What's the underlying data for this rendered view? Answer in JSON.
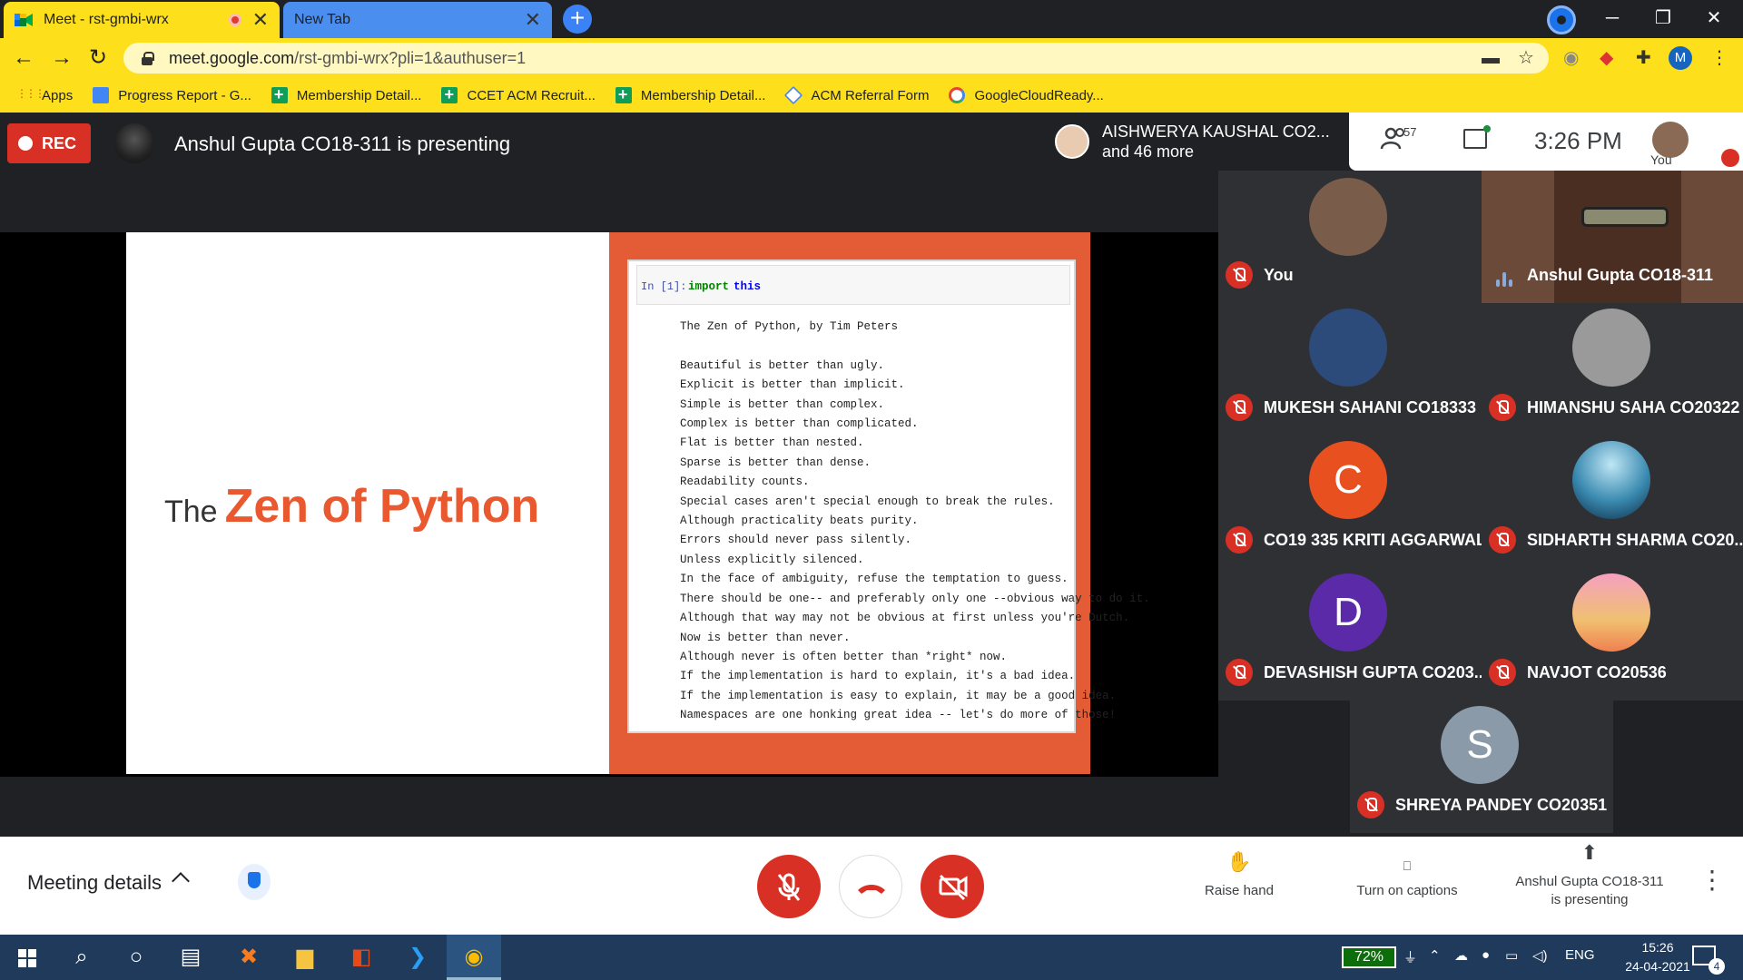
{
  "browser": {
    "tabs": [
      {
        "title": "Meet - rst-gmbi-wrx"
      },
      {
        "title": "New Tab"
      }
    ],
    "url_host": "meet.google.com",
    "url_path": "/rst-gmbi-wrx?pli=1&authuser=1",
    "profile_initial": "M",
    "bookmarks": [
      {
        "label": "Apps",
        "icon": "apps-grid-icon"
      },
      {
        "label": "Progress Report - G...",
        "icon": "docs-icon"
      },
      {
        "label": "Membership Detail...",
        "icon": "sheets-icon"
      },
      {
        "label": "CCET ACM Recruit...",
        "icon": "sheets-icon"
      },
      {
        "label": "Membership Detail...",
        "icon": "sheets-icon"
      },
      {
        "label": "ACM Referral Form",
        "icon": "form-icon"
      },
      {
        "label": "GoogleCloudReady...",
        "icon": "google-icon"
      }
    ]
  },
  "meet": {
    "rec_label": "REC",
    "presenting_title": "Anshul Gupta CO18-311 is presenting",
    "notification": {
      "line1": "AISHWERYA KAUSHAL CO2...",
      "line2": "and 46 more"
    },
    "participant_count": "57",
    "clock": "3:26 PM",
    "self_label": "You",
    "slide": {
      "title_prefix": "The",
      "title_main": "Zen of Python",
      "prompt": "In [1]:",
      "code_kw": "import",
      "code_mod": "this",
      "zen_text": "The Zen of Python, by Tim Peters\n\nBeautiful is better than ugly.\nExplicit is better than implicit.\nSimple is better than complex.\nComplex is better than complicated.\nFlat is better than nested.\nSparse is better than dense.\nReadability counts.\nSpecial cases aren't special enough to break the rules.\nAlthough practicality beats purity.\nErrors should never pass silently.\nUnless explicitly silenced.\nIn the face of ambiguity, refuse the temptation to guess.\nThere should be one-- and preferably only one --obvious way to do it.\nAlthough that way may not be obvious at first unless you're Dutch.\nNow is better than never.\nAlthough never is often better than *right* now.\nIf the implementation is hard to explain, it's a bad idea.\nIf the implementation is easy to explain, it may be a good idea.\nNamespaces are one honking great idea -- let's do more of those!"
    },
    "participants": [
      {
        "name": "You",
        "avatar_color": "#7a5c4a",
        "initial": ""
      },
      {
        "name": "Anshul Gupta CO18-311",
        "avatar_color": "#5a3a30",
        "initial": ""
      },
      {
        "name": "MUKESH SAHANI CO18333",
        "avatar_color": "#2c4a7a",
        "initial": ""
      },
      {
        "name": "HIMANSHU SAHA CO20322",
        "avatar_color": "#9a9a9a",
        "initial": ""
      },
      {
        "name": "CO19 335 KRITI AGGARWAL",
        "avatar_color": "#e8501f",
        "initial": "C"
      },
      {
        "name": "SIDHARTH SHARMA CO20...",
        "avatar_color": "#3a8ab0",
        "initial": ""
      },
      {
        "name": "DEVASHISH GUPTA CO203...",
        "avatar_color": "#5b2aa8",
        "initial": "D"
      },
      {
        "name": "NAVJOT CO20536",
        "avatar_color": "#f0a070",
        "initial": ""
      },
      {
        "name": "SHREYA PANDEY CO20351",
        "avatar_color": "#8a9aa8",
        "initial": "S"
      }
    ],
    "bottom": {
      "meeting_details": "Meeting details",
      "raise_hand": "Raise hand",
      "captions": "Turn on captions",
      "presenting_line1": "Anshul Gupta CO18-311",
      "presenting_line2": "is presenting"
    }
  },
  "taskbar": {
    "battery": "72%",
    "lang": "ENG",
    "time": "15:26",
    "date": "24-04-2021",
    "notifications": "4"
  }
}
